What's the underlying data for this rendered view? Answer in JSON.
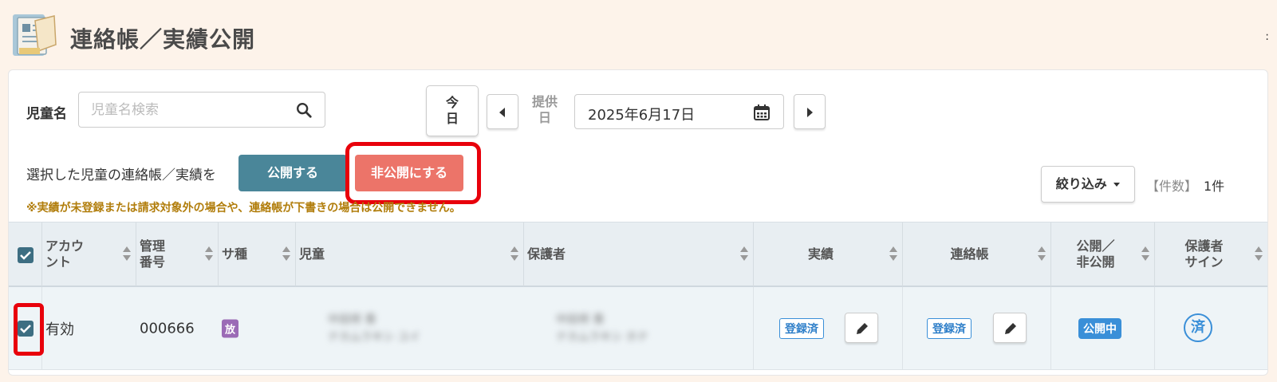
{
  "header": {
    "title": "連絡帳／実績公開",
    "icon": "notebook-icon",
    "corner_dots": ":"
  },
  "filters": {
    "child_label": "児童名",
    "search_placeholder": "児童名検索",
    "today_top": "今",
    "today_bottom": "日",
    "date_label_top": "提供",
    "date_label_bottom": "日",
    "date_value": "2025年6月17日"
  },
  "actions": {
    "selection_label": "選択した児童の連絡帳／実績を",
    "publish_label": "公開する",
    "unpublish_label": "非公開にする",
    "notice": "※実績が未登録または請求対象外の場合や、連絡帳が下書きの場合は公開できません。",
    "filter_label": "絞り込み",
    "count_label": "【件数】",
    "count_value": "1件"
  },
  "table": {
    "headers": {
      "account_l1": "アカウ",
      "account_l2": "ント",
      "mgmt_l1": "管理",
      "mgmt_l2": "番号",
      "service": "サ種",
      "child": "児童",
      "guardian": "保護者",
      "record": "実績",
      "notebook": "連絡帳",
      "public_l1": "公開／",
      "public_l2": "非公開",
      "sign_l1": "保護者",
      "sign_l2": "サイン"
    },
    "rows": [
      {
        "account": "有効",
        "mgmt_no": "000666",
        "service": "放",
        "child_name": "中田将 香",
        "child_kana": "ナカムラキシ ユイ",
        "guardian_name": "中田将 香",
        "guardian_kana": "ナカムラキシ ホナ",
        "record_status": "登録済",
        "notebook_status": "登録済",
        "public_status": "公開中",
        "sign": "済"
      }
    ]
  },
  "colors": {
    "publish": "#4a8699",
    "unpublish": "#ec7469",
    "highlight": "#e8000b",
    "notice": "#b17d0b",
    "accent_blue": "#3a8fd8",
    "service_badge": "#9b6bb6"
  }
}
